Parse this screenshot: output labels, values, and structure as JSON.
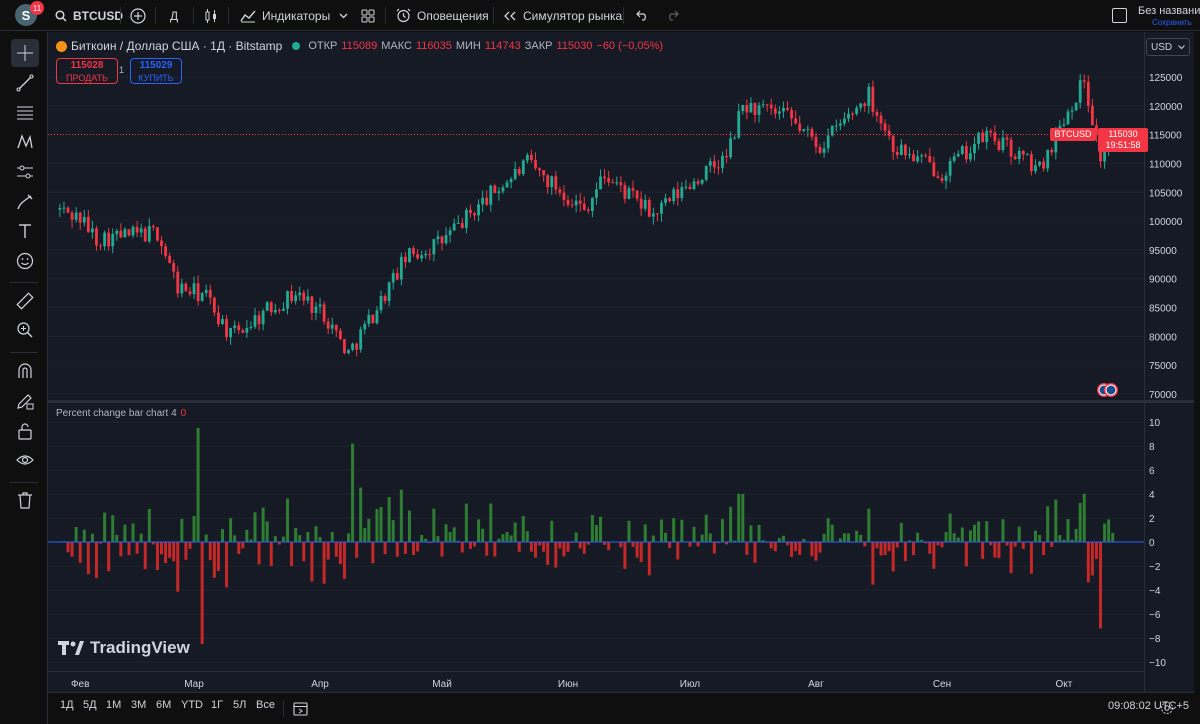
{
  "topbar": {
    "avatar_letter": "S",
    "notifications": "11",
    "symbol": "BTCUSD",
    "interval": "Д",
    "indicators_label": "Индикаторы",
    "alerts_label": "Оповещения",
    "replay_label": "Симулятор рынка",
    "doc_title": "Без названия",
    "doc_save": "Сохранить"
  },
  "legend": {
    "title": "Биткоин / Доллар США · 1Д · Bitstamp",
    "open_label": "ОТКР",
    "open": "115089",
    "high_label": "МАКС",
    "high": "116035",
    "low_label": "МИН",
    "low": "114743",
    "close_label": "ЗАКР",
    "close": "115030",
    "change": "−60 (−0,05%)"
  },
  "trade": {
    "sell_price": "115028",
    "sell_label": "ПРОДАТЬ",
    "spread": "1",
    "buy_price": "115029",
    "buy_label": "КУПИТЬ"
  },
  "currency": "USD",
  "price_tag": {
    "symbol": "BTCUSD",
    "price": "115030",
    "countdown": "19:51:58"
  },
  "indicator": {
    "name": "Percent change bar chart 4",
    "value": "0"
  },
  "brand": "TradingView",
  "price_axis_labels": [
    "125000",
    "120000",
    "115000",
    "110000",
    "105000",
    "100000",
    "95000",
    "90000",
    "85000",
    "80000",
    "75000",
    "70000"
  ],
  "ind_axis_labels": [
    "10",
    "8",
    "6",
    "4",
    "2",
    "0",
    "−2",
    "−4",
    "−6",
    "−8",
    "−10"
  ],
  "time_labels": [
    "Фев",
    "Мар",
    "Апр",
    "Май",
    "Июн",
    "Июл",
    "Авг",
    "Сен",
    "Окт"
  ],
  "bottombar": {
    "ranges": [
      "1Д",
      "5Д",
      "1М",
      "3М",
      "6М",
      "YTD",
      "1Г",
      "5Л",
      "Все"
    ],
    "clock": "09:08:02 UTC+5"
  },
  "colors": {
    "up": "#22ab94",
    "down": "#f23645",
    "bar_up": "#2e7d32",
    "bar_down": "#c62828"
  },
  "chart_data": {
    "type": "candlestick",
    "ylim": [
      70000,
      127000
    ],
    "anchor_closes": [
      {
        "date": "2025-01-27",
        "close": 102000
      },
      {
        "date": "2025-02-01",
        "close": 100500
      },
      {
        "date": "2025-02-05",
        "close": 97000
      },
      {
        "date": "2025-02-20",
        "close": 98000
      },
      {
        "date": "2025-02-25",
        "close": 88500
      },
      {
        "date": "2025-03-04",
        "close": 87000
      },
      {
        "date": "2025-03-10",
        "close": 80000
      },
      {
        "date": "2025-03-20",
        "close": 85000
      },
      {
        "date": "2025-03-26",
        "close": 87500
      },
      {
        "date": "2025-04-02",
        "close": 84000
      },
      {
        "date": "2025-04-08",
        "close": 77000
      },
      {
        "date": "2025-04-15",
        "close": 85000
      },
      {
        "date": "2025-04-22",
        "close": 93500
      },
      {
        "date": "2025-05-01",
        "close": 96500
      },
      {
        "date": "2025-05-12",
        "close": 104000
      },
      {
        "date": "2025-05-22",
        "close": 110000
      },
      {
        "date": "2025-06-05",
        "close": 102000
      },
      {
        "date": "2025-06-10",
        "close": 108000
      },
      {
        "date": "2025-06-22",
        "close": 101000
      },
      {
        "date": "2025-07-01",
        "close": 106500
      },
      {
        "date": "2025-07-10",
        "close": 111000
      },
      {
        "date": "2025-07-14",
        "close": 120000
      },
      {
        "date": "2025-07-25",
        "close": 118000
      },
      {
        "date": "2025-08-02",
        "close": 113000
      },
      {
        "date": "2025-08-14",
        "close": 122000
      },
      {
        "date": "2025-08-20",
        "close": 113000
      },
      {
        "date": "2025-09-01",
        "close": 108500
      },
      {
        "date": "2025-09-12",
        "close": 115000
      },
      {
        "date": "2025-09-25",
        "close": 109000
      },
      {
        "date": "2025-10-01",
        "close": 118000
      },
      {
        "date": "2025-10-06",
        "close": 124500
      },
      {
        "date": "2025-10-10",
        "close": 111000
      },
      {
        "date": "2025-10-13",
        "close": 115030
      }
    ],
    "percent_change": {
      "ylim": [
        -10,
        10
      ],
      "notable_bars": [
        {
          "date": "2025-03-02",
          "value": 9.5
        },
        {
          "date": "2025-03-03",
          "value": -8.5
        },
        {
          "date": "2025-04-09",
          "value": 8.2
        },
        {
          "date": "2025-07-14",
          "value": 4.0
        },
        {
          "date": "2025-10-06",
          "value": 4.0
        },
        {
          "date": "2025-10-10",
          "value": -7.2
        }
      ]
    }
  }
}
